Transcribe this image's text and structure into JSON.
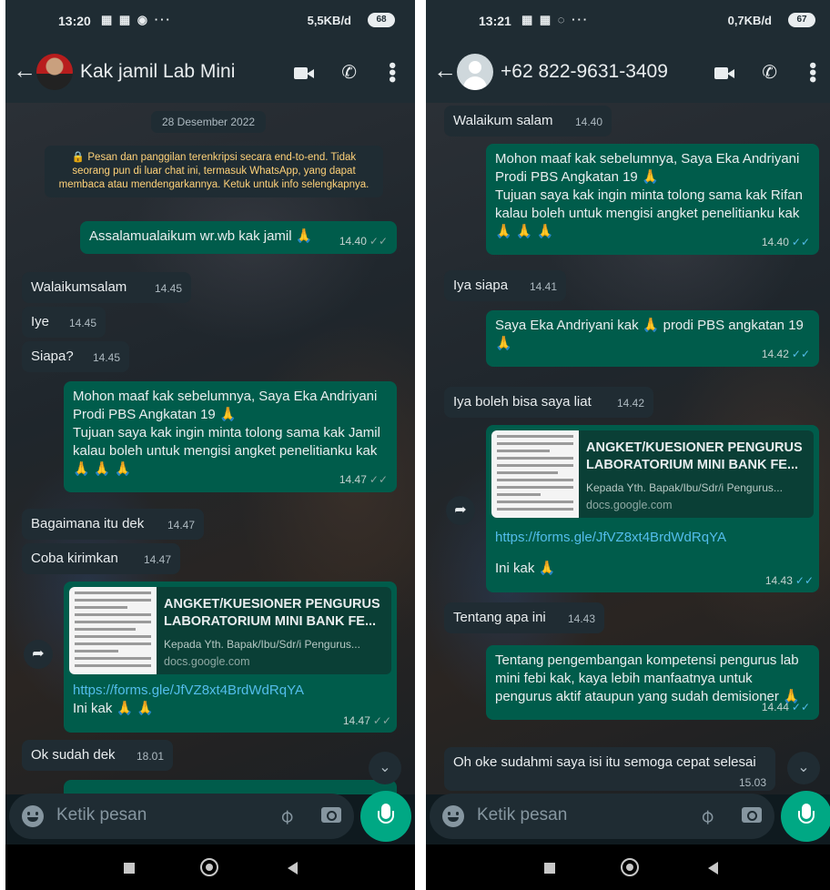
{
  "left": {
    "status": {
      "time": "13:20",
      "notif": "▦ ▦ ◉  ···",
      "speed": "5,5KB/d",
      "signal": "⏰ ⁴ᴳ.ıll",
      "battery": "68"
    },
    "contact": "Kak jamil Lab Mini",
    "date_chip": "28 Desember 2022",
    "encryption_notice": "🔒 Pesan dan panggilan terenkripsi secara end-to-end. Tidak seorang pun di luar chat ini, termasuk WhatsApp, yang dapat membaca atau mendengarkannya. Ketuk untuk info selengkapnya.",
    "messages": [
      {
        "text": "Assalamualaikum wr.wb kak jamil 🙏",
        "time": "14.40"
      },
      {
        "text": "Walaikumsalam",
        "time": "14.45"
      },
      {
        "text": "Iye",
        "time": "14.45"
      },
      {
        "text": "Siapa?",
        "time": "14.45"
      },
      {
        "text": "Mohon maaf kak sebelumnya, Saya Eka Andriyani Prodi PBS Angkatan 19 🙏",
        "text2": "Tujuan saya kak ingin minta tolong sama kak Jamil kalau boleh untuk mengisi angket penelitianku kak 🙏 🙏 🙏",
        "time": "14.47"
      },
      {
        "text": "Bagaimana itu dek",
        "time": "14.47"
      },
      {
        "text": "Coba kirimkan",
        "time": "14.47"
      },
      {
        "link_title": "ANGKET/KUESIONER PENGURUS LABORATORIUM MINI BANK FE...",
        "link_desc": "Kepada Yth. Bapak/Ibu/Sdr/i Pengurus...",
        "link_domain": "docs.google.com",
        "url": "https://forms.gle/JfVZ8xt4BrdWdRqYA",
        "text": "Ini kak 🙏 🙏",
        "time": "14.47"
      },
      {
        "text": "Ok sudah dek",
        "time": "18.01"
      }
    ],
    "input_placeholder": "Ketik pesan"
  },
  "right": {
    "status": {
      "time": "13:21",
      "notif": "▦ ▦ ◌  ···",
      "speed": "0,7KB/d",
      "signal": "⏰ ⁴ᴳ.ıll",
      "battery": "67"
    },
    "contact": "+62 822-9631-3409",
    "messages": [
      {
        "text": "Walaikum salam",
        "time": "14.40"
      },
      {
        "text": "Mohon maaf kak sebelumnya, Saya Eka Andriyani Prodi PBS Angkatan 19 🙏",
        "text2": "Tujuan saya kak ingin minta tolong sama kak Rifan kalau boleh untuk mengisi angket penelitianku kak 🙏 🙏 🙏",
        "time": "14.40"
      },
      {
        "text": "Iya siapa",
        "time": "14.41"
      },
      {
        "text": "Saya Eka Andriyani kak 🙏 prodi PBS angkatan 19 🙏",
        "time": "14.42"
      },
      {
        "text": "Iya boleh bisa saya liat",
        "time": "14.42"
      },
      {
        "link_title": "ANGKET/KUESIONER PENGURUS LABORATORIUM MINI BANK FE...",
        "link_desc": "Kepada Yth. Bapak/Ibu/Sdr/i Pengurus...",
        "link_domain": "docs.google.com",
        "url": "https://forms.gle/JfVZ8xt4BrdWdRqYA",
        "text": "Ini kak 🙏",
        "time": "14.43"
      },
      {
        "text": "Tentang apa ini",
        "time": "14.43"
      },
      {
        "text": "Tentang pengembangan kompetensi pengurus lab mini febi kak, kaya lebih manfaatnya untuk pengurus aktif ataupun yang sudah demisioner 🙏",
        "time": "14.44"
      },
      {
        "text": "Oh oke sudahmi saya isi itu semoga cepat selesai",
        "time": "15.03"
      }
    ],
    "input_placeholder": "Ketik pesan"
  },
  "colors": {
    "outgoing": "#005c4b",
    "incoming": "#202c33",
    "accent": "#00a884",
    "read_tick": "#53bdeb"
  }
}
